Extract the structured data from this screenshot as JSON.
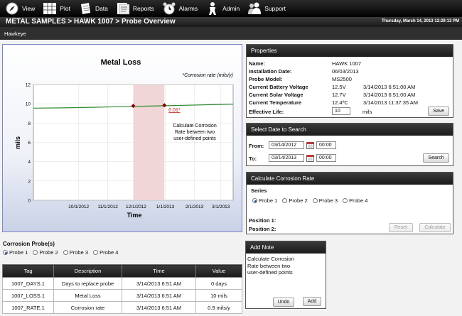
{
  "nav": [
    {
      "label": "View",
      "icon": "compass-icon"
    },
    {
      "label": "Plot",
      "icon": "grid-plot-icon"
    },
    {
      "label": "Data",
      "icon": "notepad-icon"
    },
    {
      "label": "Reports",
      "icon": "report-icon"
    },
    {
      "label": "Alarms",
      "icon": "alarm-clock-icon"
    },
    {
      "label": "Admin",
      "icon": "person-icon"
    },
    {
      "label": "Support",
      "icon": "people-icon"
    }
  ],
  "header": {
    "breadcrumb": "METAL SAMPLES >  HAWK 1007 > Probe Overview",
    "datetime": "Thursday, March 14, 2013 12:29:13 PM"
  },
  "subheader": {
    "label": "Hawkeye"
  },
  "chart_data": {
    "type": "line",
    "title": "Metal Loss",
    "legend_note": "*Corrosion rate (mils/y)",
    "xlabel": "Time",
    "ylabel": "mils",
    "x_ticks": [
      "10/1/2012",
      "11/1/2012",
      "12/1/2012",
      "1/1/2013",
      "2/1/2013",
      "3/1/2013"
    ],
    "y_ticks": [
      "0",
      "2",
      "4",
      "6",
      "8",
      "10",
      "12"
    ],
    "xlim": [
      "2012-08-14",
      "2013-03-14"
    ],
    "ylim": [
      0,
      12
    ],
    "series": [
      {
        "x": [
          "2012-08-14",
          "2012-09-15",
          "2012-10-15",
          "2012-11-15",
          "2012-12-15",
          "2013-01-15",
          "2013-02-15",
          "2013-03-14"
        ],
        "values": [
          9.55,
          9.58,
          9.64,
          9.7,
          9.76,
          9.83,
          9.9,
          9.97
        ]
      }
    ],
    "highlight_range": [
      "2012-11-28",
      "2012-12-31"
    ],
    "markers": [
      {
        "x": "2012-11-28",
        "y": 9.78
      },
      {
        "x": "2012-12-31",
        "y": 9.85
      }
    ],
    "rate_label": "0.01*",
    "annotation": [
      "Calculate Corrosion",
      "Rate between two",
      "user-defined points"
    ],
    "colors": {
      "line": "#2f8a2f",
      "highlight": "#f0d6d6",
      "marker": "#8b0000",
      "rate": "#b00000"
    }
  },
  "properties": {
    "title": "Properties",
    "rows": [
      {
        "label": "Name:",
        "value": "HAWK 1007",
        "extra": ""
      },
      {
        "label": "Installation Date:",
        "value": "06/03/2013",
        "extra": ""
      },
      {
        "label": "Probe Model:",
        "value": "MS2500",
        "extra": ""
      },
      {
        "label": "Current Battery Voltage",
        "value": "12.5V",
        "extra": "3/14/2013 6:51:00 AM"
      },
      {
        "label": "Current Solar Voltage",
        "value": "12.7V",
        "extra": "3/14/2013 6:51:00 AM"
      },
      {
        "label": "Current Temperature",
        "value": "12.4ºC",
        "extra": "3/14/2013 11:37:35 AM"
      }
    ],
    "effective_life_label": "Effective Life:",
    "effective_life_value": "10",
    "effective_life_unit": "mils",
    "save_label": "Save"
  },
  "date_search": {
    "title": "Select Date to Search",
    "from_label": "From:",
    "from_date": "03/14/2012",
    "from_time": "00:00",
    "to_label": "To:",
    "to_date": "03/14/2013",
    "to_time": "00:00",
    "search_label": "Search"
  },
  "corrosion_rate": {
    "title": "Calculate Corrosion Rate",
    "series_label": "Series",
    "probes": [
      "Probe 1",
      "Probe 2",
      "Probe 3",
      "Probe 4"
    ],
    "selected": 0,
    "position1_label": "Position 1:",
    "position2_label": "Position 2:",
    "reset_label": "Reset",
    "calculate_label": "Calculate"
  },
  "corrosion_probes": {
    "title": "Corrosion Probe(s)",
    "probes": [
      "Probe 1",
      "Probe 2",
      "Probe 3",
      "Probe 4"
    ],
    "selected": 0
  },
  "add_note": {
    "title": "Add Note",
    "text": "Calculate Corrosion\nRate between two\nuser-defined points",
    "undo_label": "Undo",
    "add_label": "Add"
  },
  "tags_table": {
    "headers": [
      "Tag",
      "Description",
      "Time",
      "Value"
    ],
    "rows": [
      [
        "1007_DAYS.1",
        "Days to replace probe",
        "3/14/2013 6:51 AM",
        "0 days"
      ],
      [
        "1007_LOSS.1",
        "Metal Loss",
        "3/14/2013 6:51 AM",
        "10 mils"
      ],
      [
        "1007_RATE.1",
        "Corrosion rate",
        "3/14/2013 6:51 AM",
        "0.9 mils/y"
      ]
    ]
  }
}
